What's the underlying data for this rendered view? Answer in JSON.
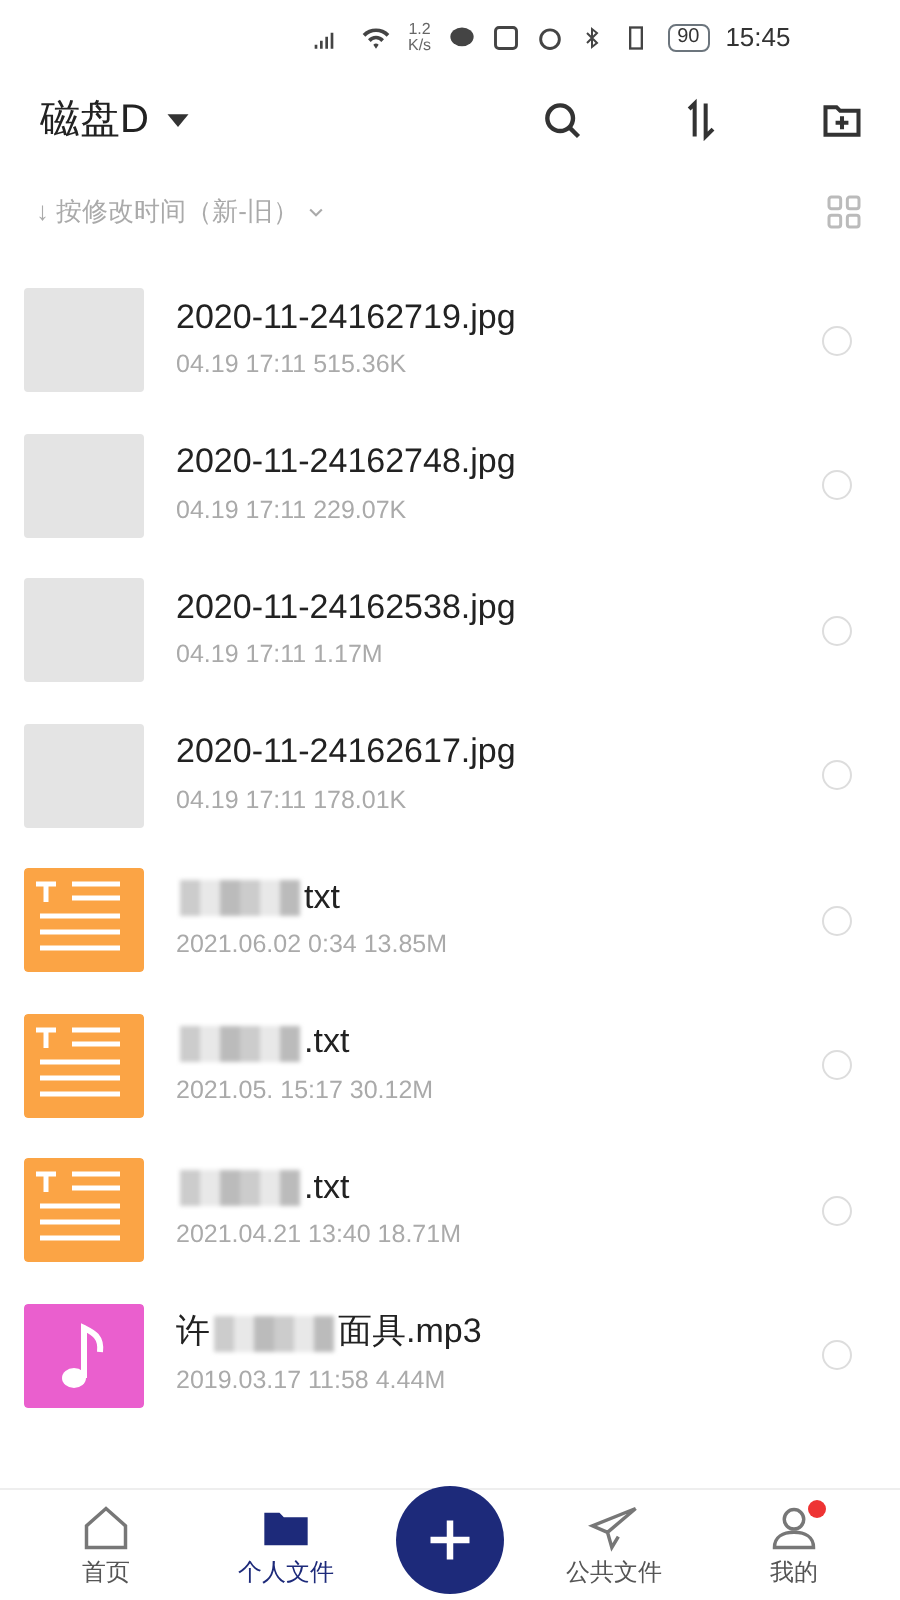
{
  "status_bar": {
    "speed": "1.2",
    "speed_unit": "K/s",
    "battery": "90",
    "time": "15:45"
  },
  "header": {
    "title": "磁盘D"
  },
  "sort": {
    "label": "↓ 按修改时间（新-旧）"
  },
  "files": [
    {
      "kind": "image",
      "name": "2020-11-24162719.jpg",
      "meta": "04.19 17:11 515.36K",
      "selected": false,
      "redacted": false
    },
    {
      "kind": "image",
      "name": "2020-11-24162748.jpg",
      "meta": "04.19 17:11 229.07K",
      "selected": false,
      "redacted": false
    },
    {
      "kind": "image",
      "name": "2020-11-24162538.jpg",
      "meta": "04.19 17:11 1.17M",
      "selected": false,
      "redacted": false
    },
    {
      "kind": "image",
      "name": "2020-11-24162617.jpg",
      "meta": "04.19 17:11 178.01K",
      "selected": false,
      "redacted": false
    },
    {
      "kind": "text",
      "name": "txt",
      "meta": "2021.06.02 0:34 13.85M",
      "selected": false,
      "redacted": true
    },
    {
      "kind": "text",
      "name": ".txt",
      "meta": "2021.05. 15:17 30.12M",
      "selected": false,
      "redacted": true
    },
    {
      "kind": "text",
      "name": ".txt",
      "meta": "2021.04.21 13:40 18.71M",
      "selected": false,
      "redacted": true
    },
    {
      "kind": "audio",
      "prefix": "许",
      "name": "面具.mp3",
      "meta": "2019.03.17 11:58 4.44M",
      "selected": false,
      "redacted": true
    }
  ],
  "nav": [
    {
      "kind": "home",
      "label": "首页",
      "selected": false,
      "badge": false
    },
    {
      "kind": "folder",
      "label": "个人文件",
      "selected": true,
      "badge": false
    },
    {
      "kind": "add"
    },
    {
      "kind": "send",
      "label": "公共文件",
      "selected": false,
      "badge": false
    },
    {
      "kind": "user",
      "label": "我的",
      "selected": false,
      "badge": true
    }
  ]
}
